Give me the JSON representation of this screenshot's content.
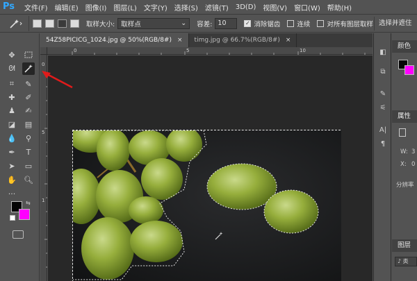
{
  "app": {
    "logo": "Ps"
  },
  "menu": [
    "文件(F)",
    "编辑(E)",
    "图像(I)",
    "图层(L)",
    "文字(Y)",
    "选择(S)",
    "滤镜(T)",
    "3D(D)",
    "视图(V)",
    "窗口(W)",
    "帮助(H)"
  ],
  "options": {
    "sample_size_label": "取样大小:",
    "sample_size_value": "取样点",
    "tolerance_label": "容差:",
    "tolerance_value": "10",
    "anti_alias_label": "消除锯齿",
    "contiguous_label": "连续",
    "sample_all_label": "对所有图层取样",
    "select_mask_label": "选择并遮住",
    "anti_alias_checked": true,
    "contiguous_checked": false,
    "sample_all_checked": false
  },
  "tabs": [
    {
      "label": "54Z58PICICG_1024.jpg @ 50%(RGB/8#)",
      "close": "×"
    },
    {
      "label": "timg.jpg @ 66.7%(RGB/8#)",
      "close": "×"
    }
  ],
  "ruler": {
    "h": [
      "0",
      "5",
      "10"
    ],
    "v": [
      "0",
      "5",
      "1"
    ]
  },
  "swatches": {
    "foreground": "#050505",
    "background": "#ff00ff"
  },
  "right_panel": {
    "color_title": "颜色",
    "properties_title": "属性",
    "prop_w": "W:",
    "prop_x": "X:",
    "prop_w_value": "3",
    "prop_x_value": "0",
    "mask_label": "分辨率",
    "layers_title": "图层",
    "layers_search": "♪ 类"
  },
  "icons": {
    "tool_selected": "magic-wand",
    "pointer_arrow_color": "#e01b1b"
  }
}
